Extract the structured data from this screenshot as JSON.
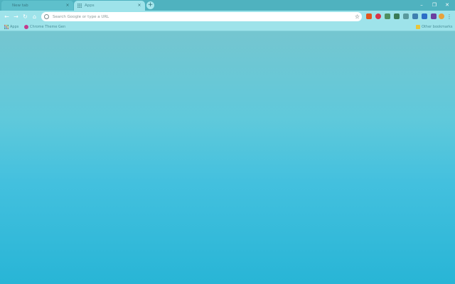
{
  "tabs": [
    {
      "title": "New tab",
      "close": "×"
    },
    {
      "title": "Apps",
      "close": "×"
    }
  ],
  "newtab_label": "+",
  "window_controls": {
    "minimize": "–",
    "restore": "❐",
    "close": "✕"
  },
  "toolbar": {
    "back": "←",
    "forward": "→",
    "reload": "↻",
    "home": "⌂"
  },
  "omnibox": {
    "placeholder": "Search Google or type a URL",
    "bookmark_star": "☆"
  },
  "extensions": [
    {
      "name": "extension-1-icon",
      "color": "#e2571e"
    },
    {
      "name": "extension-2-icon",
      "color": "#d8344a"
    },
    {
      "name": "extension-3-icon",
      "color": "#4f8f60"
    },
    {
      "name": "extension-4-icon",
      "color": "#3a7a55"
    },
    {
      "name": "extension-5-icon",
      "color": "#5a9a9e"
    },
    {
      "name": "extension-6-icon",
      "color": "#3f7fb0"
    },
    {
      "name": "extension-7-icon",
      "color": "#2d6ec7"
    },
    {
      "name": "extension-8-icon",
      "color": "#6a3fa0"
    },
    {
      "name": "extension-9-icon",
      "color": "#7a9aa0"
    },
    {
      "name": "profile-avatar",
      "color": "#e8a23a"
    }
  ],
  "menu_label": "⋮",
  "bookmarks": {
    "apps": "Apps",
    "item1": "Chrome Theme Gen",
    "other": "Other bookmarks"
  },
  "colors": {
    "frame": "#4fb2bf",
    "active_tab": "#9ee3ea",
    "toolbar": "#9ee3ea",
    "ntp_top": "#75c6d0",
    "ntp_bottom": "#28b5d6"
  }
}
